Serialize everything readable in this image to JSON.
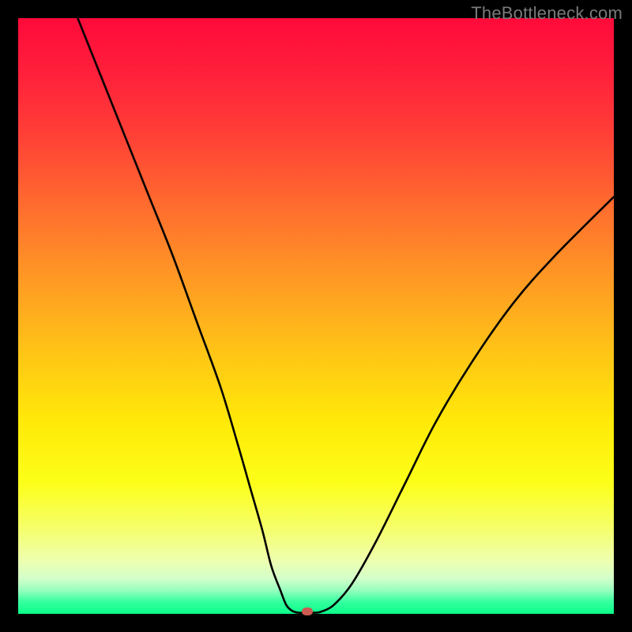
{
  "watermark": "TheBottleneck.com",
  "chart_data": {
    "type": "line",
    "title": "",
    "xlabel": "",
    "ylabel": "",
    "xlim": [
      0,
      100
    ],
    "ylim": [
      0,
      100
    ],
    "series": [
      {
        "name": "curve",
        "x": [
          10,
          14,
          18,
          22,
          26,
          30,
          34,
          37,
          39,
          41,
          42.5,
          44,
          45,
          46,
          47,
          48,
          50,
          51,
          53,
          56,
          60,
          65,
          70,
          76,
          83,
          90,
          100
        ],
        "y": [
          100,
          90,
          80,
          70,
          60,
          49,
          38,
          28,
          21,
          14,
          8,
          4,
          1.5,
          0.5,
          0.2,
          0.2,
          0.2,
          0.4,
          1.5,
          5,
          12,
          22,
          32,
          42,
          52,
          60,
          70
        ]
      }
    ],
    "marker": {
      "x": 48.5,
      "y": 0.4
    },
    "background_gradient": {
      "top": "#ff0a3a",
      "mid": "#ffea08",
      "bottom": "#0aff8a"
    }
  }
}
